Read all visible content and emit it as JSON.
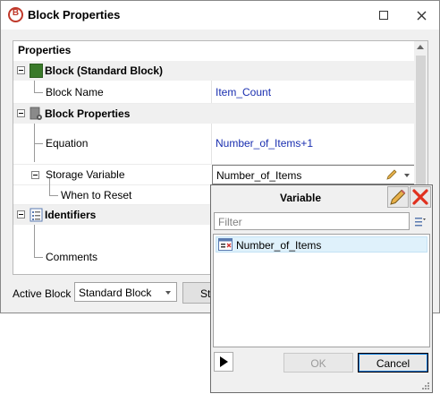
{
  "window": {
    "title": "Block Properties",
    "controls": [
      "maximize",
      "close"
    ]
  },
  "panel": {
    "header": "Properties",
    "categories": [
      {
        "label": "Block (Standard Block)",
        "icon": "green-block-icon",
        "properties": [
          {
            "name": "Block Name",
            "value": "Item_Count"
          }
        ]
      },
      {
        "label": "Block Properties",
        "icon": "block-gear-icon",
        "properties": [
          {
            "name": "Equation",
            "value": "Number_of_Items+1"
          },
          {
            "name": "Storage Variable",
            "value": "Number_of_Items"
          },
          {
            "name": "When to Reset",
            "value": ""
          }
        ]
      },
      {
        "label": "Identifiers",
        "icon": "list-icon",
        "properties": [
          {
            "name": "Comments",
            "value": ""
          }
        ]
      }
    ]
  },
  "bottom": {
    "active_block_label": "Active Block",
    "active_block_value": "Standard Block",
    "partial_button_label": "St"
  },
  "popup": {
    "title": "Variable",
    "filter_placeholder": "Filter",
    "items": [
      "Number_of_Items"
    ],
    "ok_label": "OK",
    "cancel_label": "Cancel"
  },
  "colors": {
    "value_text": "#1a2fb0",
    "category_bg": "#f0f0f0",
    "selection_bg": "#dff1fb",
    "close_red": "#e0301e"
  }
}
